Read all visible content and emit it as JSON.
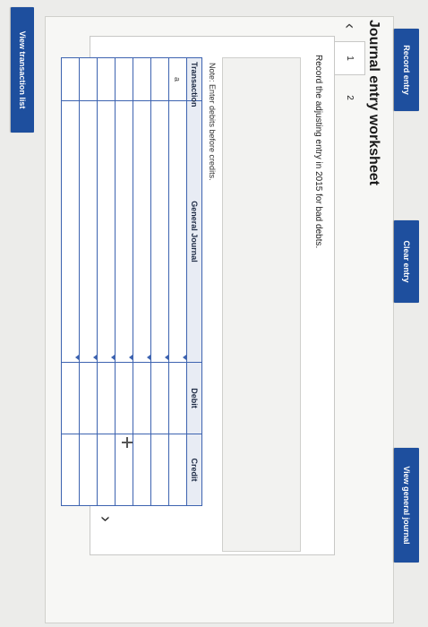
{
  "toolbar": {
    "view_transactions_label": "View transaction list"
  },
  "worksheet": {
    "title": "Journal entry worksheet",
    "tabs": [
      {
        "label": "1"
      },
      {
        "label": "2"
      }
    ],
    "instruction": "Record the adjusting entry in 2015 for bad debts.",
    "note": "Note: Enter debits before credits."
  },
  "table": {
    "headers": {
      "transaction": "Transaction",
      "account": "General Journal",
      "debit": "Debit",
      "credit": "Credit"
    },
    "rows": [
      {
        "transaction": "a"
      },
      {
        "transaction": ""
      },
      {
        "transaction": ""
      },
      {
        "transaction": ""
      },
      {
        "transaction": ""
      },
      {
        "transaction": ""
      },
      {
        "transaction": ""
      }
    ]
  },
  "actions": {
    "record_label": "Record entry",
    "clear_label": "Clear entry",
    "view_journal_label": "View general journal"
  },
  "colors": {
    "button_blue": "#1e4f9e",
    "grid_blue": "#3d63b0"
  },
  "icons": {
    "prev": "chevron-left-icon",
    "next": "chevron-right-icon",
    "cursor": "crosshair-cursor-icon"
  }
}
